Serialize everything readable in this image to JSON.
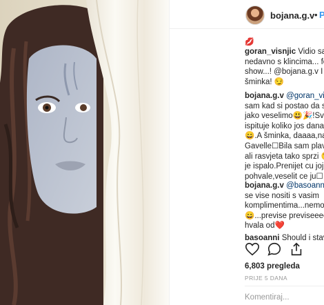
{
  "post": {
    "username": "bojana.g.v",
    "separator": "•",
    "follow_label": "P",
    "caption_emoji": "💋",
    "comments": [
      {
        "user": "goran_visnjic",
        "lines": [
          "Vidio sam",
          "nedavno s klincima... fe",
          "show...! @bojana.g.v I c",
          "šminka! 😏"
        ]
      },
      {
        "user": "bojana.g.v",
        "lines": [
          "@goran_vis",
          "sam kad si postao da s",
          "jako veselimo😃🎉!Sva",
          "ispituje koliko jos dana",
          "😄.A šminka, daaaa,na",
          "Gavelle☐Bila sam plava",
          "ali rasvjeta tako sprzi 😉",
          "je ispalo.Prenijet cu joj t",
          "pohvale,veselit ce ju☐"
        ]
      },
      {
        "user": "bojana.g.v",
        "lines": [
          "@basoanni",
          "se vise nositi s vasim",
          "komplimentima...nemoj",
          "😄...previse previseeee",
          "hvala od❤️"
        ]
      },
      {
        "user": "basoanni",
        "lines": [
          "Should i stav"
        ]
      }
    ],
    "likes": "6,803 pregleda",
    "time": "PRIJE 5 DANA",
    "comment_placeholder": "Komentiraj..."
  },
  "icons": [
    "heart-icon",
    "comment-icon",
    "share-icon"
  ]
}
